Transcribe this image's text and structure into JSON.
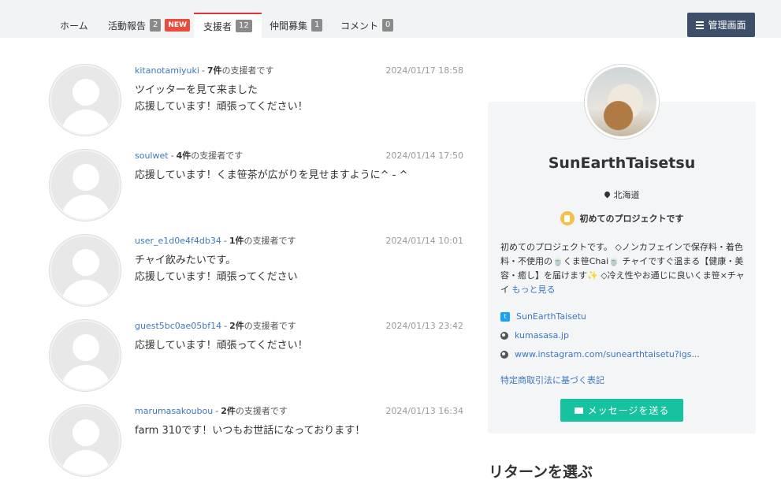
{
  "tabs": [
    {
      "label": "ホーム",
      "count": null,
      "badge": null
    },
    {
      "label": "活動報告",
      "count": "2",
      "badge": "NEW"
    },
    {
      "label": "支援者",
      "count": "12",
      "badge": null,
      "active": true
    },
    {
      "label": "仲間募集",
      "count": "1",
      "badge": null
    },
    {
      "label": "コメント",
      "count": "0",
      "badge": null
    }
  ],
  "admin_button": {
    "label": "管理画面",
    "icon": "menu-icon"
  },
  "comments": [
    {
      "user": "kitanotamiyuki",
      "sep": "-",
      "count": "7件",
      "count_suffix": "の支援者です",
      "date": "2024/01/17 18:58",
      "lines": [
        "ツイッターを見て来ました",
        "応援しています！頑張ってください！"
      ]
    },
    {
      "user": "soulwet",
      "sep": "-",
      "count": "4件",
      "count_suffix": "の支援者です",
      "date": "2024/01/14 17:50",
      "lines": [
        "応援しています！くま笹茶が広がりを見せますように^ - ^",
        ""
      ]
    },
    {
      "user": "user_e1d0e4f4db34",
      "sep": "-",
      "count": "1件",
      "count_suffix": "の支援者です",
      "date": "2024/01/14 10:01",
      "lines": [
        "チャイ飲みたいです。",
        "応援しています！頑張ってください"
      ]
    },
    {
      "user": "guest5bc0ae05bf14",
      "sep": "-",
      "count": "2件",
      "count_suffix": "の支援者です",
      "date": "2024/01/13 23:42",
      "lines": [
        "応援しています！頑張ってください！",
        ""
      ]
    },
    {
      "user": "marumasakoubou",
      "sep": "-",
      "count": "2件",
      "count_suffix": "の支援者です",
      "date": "2024/01/13 16:34",
      "lines": [
        "farm 310です！いつもお世話になっております！",
        ""
      ]
    }
  ],
  "profile": {
    "name": "SunEarthTaisetsu",
    "location": "北海道",
    "badge": "初めてのプロジェクトです",
    "description": "初めてのプロジェクトです。 ◇ノンカフェインで保存料・着色料・不使用の🍵くま笹Chai🍵 チャイですぐ温まる【健康・美容・癒し】を届けます✨ ◇冷え性やお通じに良いくま笹×チャイ",
    "more_label": "もっと見る",
    "links": [
      {
        "icon": "twitter-icon",
        "text": "SunEarthTaisetu"
      },
      {
        "icon": "globe-icon",
        "text": "kumasasa.jp"
      },
      {
        "icon": "globe-icon",
        "text": "www.instagram.com/sunearthtaisetu?igs..."
      }
    ],
    "law_link": "特定商取引法に基づく表記",
    "message_button": "メッセージを送る"
  },
  "returns_heading": "リターンを選ぶ",
  "colors": {
    "accent_red": "#d9383a",
    "link_blue": "#3a78c2",
    "admin_navy": "#3d4f68",
    "message_green": "#17c2a1"
  }
}
